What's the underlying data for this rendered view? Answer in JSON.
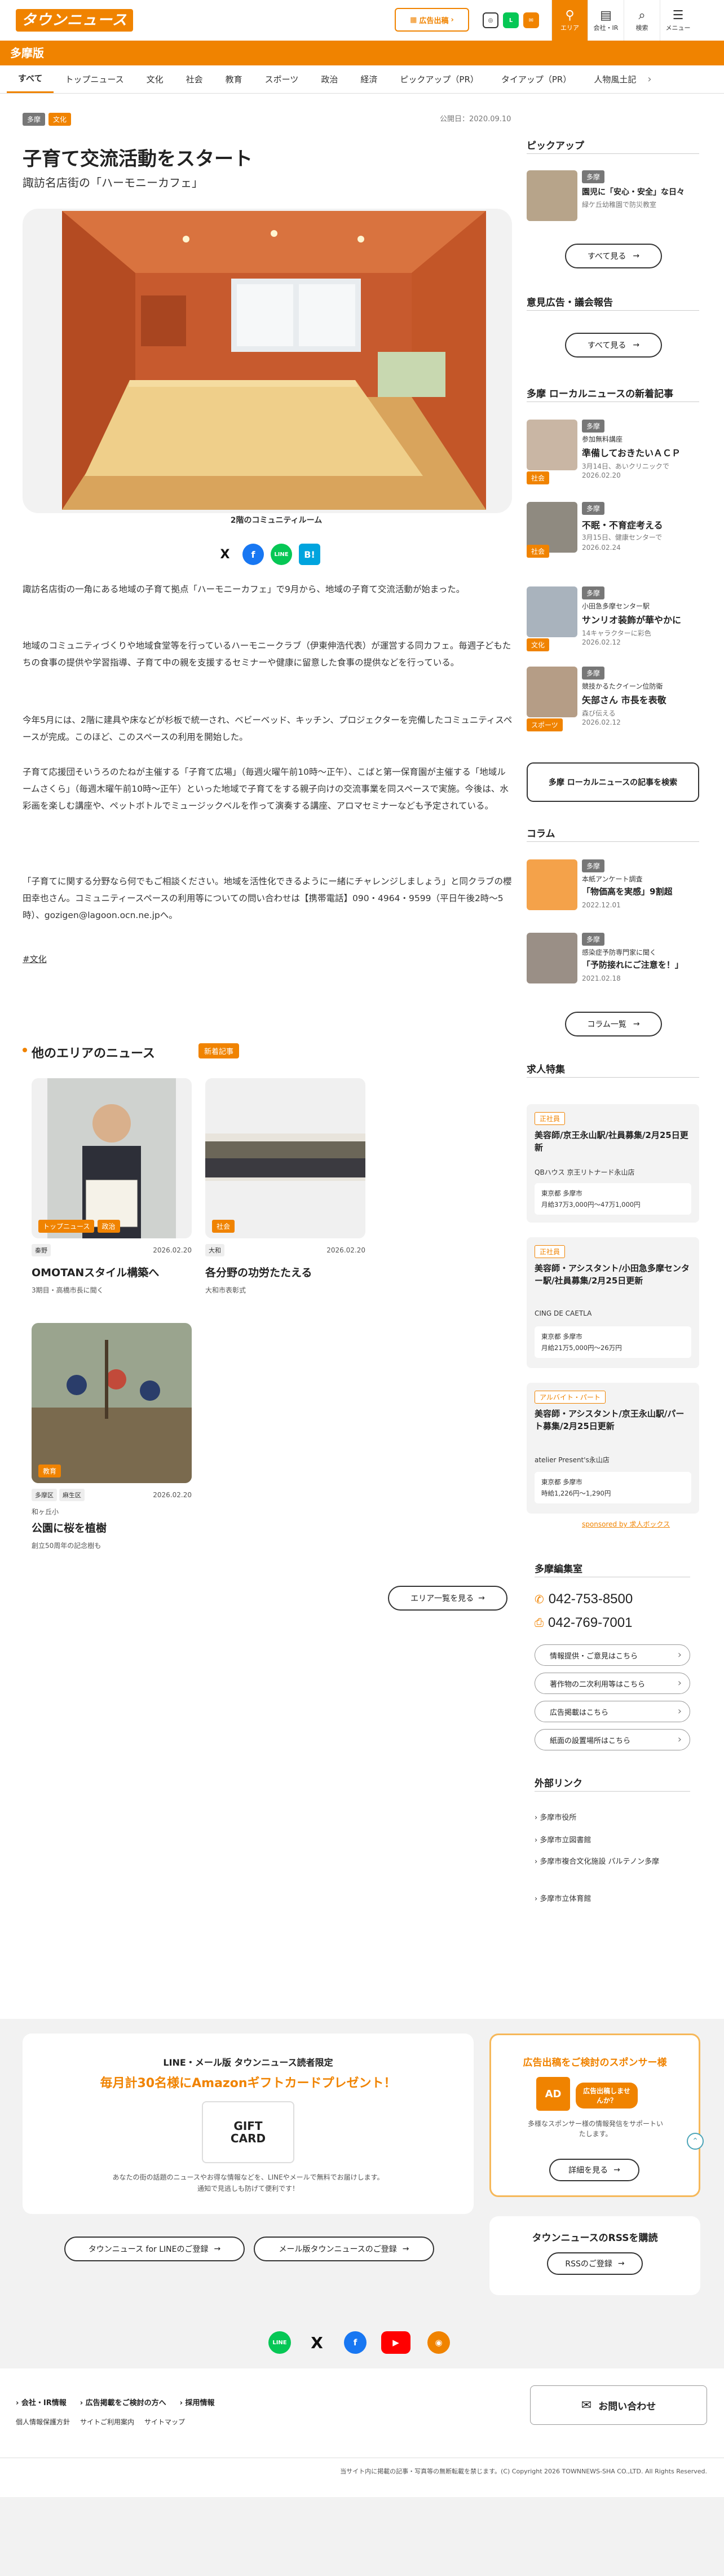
{
  "header": {
    "logo": "タウンニュース",
    "ad_button": "広告出稿",
    "nav": [
      {
        "label": "エリア",
        "icon": "pin-icon"
      },
      {
        "label": "会社・IR",
        "icon": "building-icon"
      },
      {
        "label": "検索",
        "icon": "search-icon"
      },
      {
        "label": "メニュー",
        "icon": "menu-icon"
      }
    ]
  },
  "region": "多摩版",
  "categories": [
    "すべて",
    "トップニュース",
    "文化",
    "社会",
    "教育",
    "スポーツ",
    "政治",
    "経済",
    "ピックアップ（PR）",
    "タイアップ（PR）",
    "人物風土記"
  ],
  "article": {
    "tags": [
      "多摩",
      "文化"
    ],
    "published": "公開日：2020.09.10",
    "title": "子育て交流活動をスタート",
    "subtitle": "諏訪名店街の「ハーモニーカフェ」",
    "caption": "2階のコミュニティルーム",
    "paragraphs": [
      "諏訪名店街の一角にある地域の子育て拠点「ハーモニーカフェ」で9月から、地域の子育て交流活動が始まった。",
      "地域のコミュニティづくりや地域食堂等を行っているハーモニークラブ（伊東伸浩代表）が運営する同カフェ。毎週子どもたちの食事の提供や学習指導、子育て中の親を支援するセミナーや健康に留意した食事の提供などを行っている。",
      "今年5月には、2階に建具や床などが杉板で統一され、ベビーベッド、キッチン、プロジェクターを完備したコミュニティスペースが完成。このほど、このスペースの利用を開始した。",
      "子育て応援団そいうろのたねが主催する「子育て広場」（毎週火曜午前10時〜正午）、こばと第一保育園が主催する「地域ルームさくら」（毎週木曜午前10時〜正午）といった地域で子育てをする親子向けの交流事業を同スペースで実施。今後は、水彩画を楽しむ講座や、ペットボトルでミュージックベルを作って演奏する講座、アロマセミナーなども予定されている。",
      "「子育てに関する分野なら何でもご相談ください。地域を活性化できるようにー緒にチャレンジしましょう」と同クラブの櫻田幸也さん。コミュニティースペースの利用等についての問い合わせは【携帯電話】090・4964・9599（平日午後2時〜5時）、gozigen@lagoon.ocn.ne.jpへ。"
    ],
    "category_link": "#文化",
    "share": [
      {
        "label": "X",
        "icon": "x-icon"
      },
      {
        "label": "f",
        "icon": "facebook-icon"
      },
      {
        "label": "LINE",
        "icon": "line-icon"
      },
      {
        "label": "B!",
        "icon": "hatena-icon"
      }
    ]
  },
  "other_area": {
    "title": "他のエリアのニュース",
    "badge": "新着記事",
    "cards": [
      {
        "tags": [
          "トップニュース",
          "政治"
        ],
        "location": [
          "秦野"
        ],
        "date": "2026.02.20",
        "title": "OMOTANスタイル構築へ",
        "sub": "3期目・高橋市長に聞く"
      },
      {
        "tags": [
          "社会"
        ],
        "location": [
          "大和"
        ],
        "date": "2026.02.20",
        "title": "各分野の功労たたえる",
        "sub": "大和市表彰式"
      },
      {
        "tags": [
          "教育"
        ],
        "location": [
          "多摩区",
          "麻生区"
        ],
        "date": "2026.02.20",
        "title": "公園に桜を植樹",
        "sub": "創立50周年の記念樹も",
        "kicker": "和ヶ丘小"
      }
    ],
    "more": "エリア一覧を見る"
  },
  "sidebar": {
    "pickup_title": "ピックアップ",
    "pickup": {
      "tag": "多摩",
      "title": "園児に「安心・安全」な日々",
      "sub": "緑ケ丘幼稚園で防災教室"
    },
    "see_all": "すべて見る",
    "opinion_title": "意見広告・議会報告",
    "local_title": "多摩 ローカルニュースの新着記事",
    "local": [
      {
        "tag": "多摩",
        "kicker": "参加無料講座",
        "title": "準備しておきたいＡＣＰ",
        "date": "3月14日、あいクリニックで",
        "pubdate": "2026.02.20",
        "ctag": "社会"
      },
      {
        "tag": "多摩",
        "kicker": "",
        "title": "不眠・不育症考える",
        "date": "3月15日、健康センターで",
        "pubdate": "2026.02.24",
        "ctag": "社会"
      },
      {
        "tag": "多摩",
        "kicker": "小田急多摩センター駅",
        "title": "サンリオ装飾が華やかに",
        "date": "14キャラクターに彩色",
        "pubdate": "2026.02.12",
        "ctag": "文化"
      },
      {
        "tag": "多摩",
        "kicker": "競技かるたクイーン位防衛",
        "title": "矢部さん 市長を表敬",
        "date": "森び伝える",
        "pubdate": "2026.02.12",
        "ctag": "スポーツ"
      }
    ],
    "local_more": "多摩 ローカルニュースの記事を検索",
    "column_title": "コラム",
    "columns": [
      {
        "tag": "多摩",
        "kicker": "本紙アンケート調査",
        "title": "「物価高を実感」9割超",
        "date": "2022.12.01"
      },
      {
        "tag": "多摩",
        "kicker": "感染症予防専門家に聞く",
        "title": "「予防接れにご注意を！」",
        "date": "2021.02.18"
      }
    ],
    "column_more": "コラム一覧",
    "jobs_title": "求人特集",
    "jobs": [
      {
        "type": "正社員",
        "title": "美容師/京王永山駅/社員募集/2月25日更新",
        "company": "QBハウス 京王リトナード永山店",
        "detail1": "東京都 多摩市",
        "detail2": "月給37万3,000円〜47万1,000円"
      },
      {
        "type": "正社員",
        "title": "美容師・アシスタント/小田急多摩センター駅/社員募集/2月25日更新",
        "company": "CING DE CAETLA",
        "detail1": "東京都 多摩市",
        "detail2": "月給21万5,000円〜26万円"
      },
      {
        "type": "アルバイト・パート",
        "title": "美容師・アシスタント/京王永山駅/パート募集/2月25日更新",
        "company": "atelier Present's永山店",
        "detail1": "東京都 多摩市",
        "detail2": "時給1,226円〜1,290円"
      }
    ],
    "sponsored": "sponsored by 求人ボックス",
    "editorial_title": "多摩編集室",
    "phone": "042-753-8500",
    "fax": "042-769-7001",
    "editorial_links": [
      "情報提供・ご意見はこちら",
      "著作物の二次利用等はこちら",
      "広告掲載はこちら",
      "紙面の設置場所はこちら"
    ],
    "links_title": "外部リンク",
    "links": [
      "多摩市役所",
      "多摩市立図書館",
      "多摩市複合文化施設 パルテノン多摩",
      "多摩市立体育館"
    ]
  },
  "bottom": {
    "line_label": "LINE・メール版 タウンニュース読者限定",
    "campaign": "毎月計30名様にAmazonギフトカードプレゼント！",
    "gift": "GIFT CARD",
    "desc1": "あなたの街の話題のニュースやお得な情報などを、LINEやメールで無料でお届けします。",
    "desc2": "通知で見逃しも防げて便利です！",
    "btn_line": "タウンニュース for LINEのご登録",
    "btn_mail": "メール版タウンニュースのご登録",
    "sponsor_title": "広告出稿をご検討のスポンサー様",
    "sponsor_badge": "広告出稿しませんか？",
    "sponsor_desc": "多様なスポンサー様の情報発信をサポートいたします。",
    "sponsor_btn": "詳細を見る",
    "rss_title": "タウンニュースのRSSを購読",
    "rss_btn": "RSSのご登録"
  },
  "footer": {
    "links1": [
      "会社・IR情報",
      "広告掲載をご検討の方へ",
      "採用情報"
    ],
    "links2": [
      "個人情報保護方針",
      "サイトご利用案内",
      "サイトマップ"
    ],
    "contact": "お問い合わせ",
    "copyright": "当サイト内に掲載の記事・写真等の無断転載を禁じます。(C) Copyright 2026 TOWNNEWS-SHA CO.,LTD. All Rights Reserved."
  },
  "colors": {
    "brand": "#f08300",
    "text": "#222222",
    "bg_band": "#f2f2f2"
  }
}
